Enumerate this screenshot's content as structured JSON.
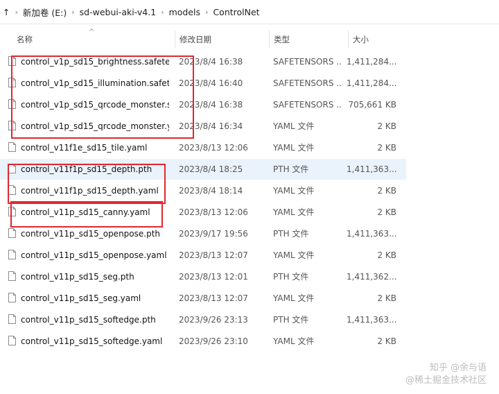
{
  "breadcrumb": {
    "lead": "↑",
    "items": [
      "新加卷 (E:)",
      "sd-webui-aki-v4.1",
      "models",
      "ControlNet"
    ]
  },
  "columns": {
    "name": "名称",
    "date": "修改日期",
    "type": "类型",
    "size": "大小"
  },
  "files": [
    {
      "name": "control_v1p_sd15_brightness.safeten...",
      "date": "2023/8/4 16:38",
      "type": "SAFETENSORS ...",
      "size": "1,411,284..."
    },
    {
      "name": "control_v1p_sd15_illumination.safete...",
      "date": "2023/8/4 16:40",
      "type": "SAFETENSORS ...",
      "size": "1,411,284..."
    },
    {
      "name": "control_v1p_sd15_qrcode_monster.s...",
      "date": "2023/8/4 16:38",
      "type": "SAFETENSORS ...",
      "size": "705,661 KB"
    },
    {
      "name": "control_v1p_sd15_qrcode_monster.y...",
      "date": "2023/8/4 16:34",
      "type": "YAML 文件",
      "size": "2 KB"
    },
    {
      "name": "control_v11f1e_sd15_tile.yaml",
      "date": "2023/8/13 12:06",
      "type": "YAML 文件",
      "size": "2 KB"
    },
    {
      "name": "control_v11f1p_sd15_depth.pth",
      "date": "2023/8/4 18:25",
      "type": "PTH 文件",
      "size": "1,411,363..."
    },
    {
      "name": "control_v11f1p_sd15_depth.yaml",
      "date": "2023/8/4 18:14",
      "type": "YAML 文件",
      "size": "2 KB"
    },
    {
      "name": "control_v11p_sd15_canny.yaml",
      "date": "2023/8/13 12:06",
      "type": "YAML 文件",
      "size": "2 KB"
    },
    {
      "name": "control_v11p_sd15_openpose.pth",
      "date": "2023/9/17 19:56",
      "type": "PTH 文件",
      "size": "1,411,363..."
    },
    {
      "name": "control_v11p_sd15_openpose.yaml",
      "date": "2023/8/13 12:07",
      "type": "YAML 文件",
      "size": "2 KB"
    },
    {
      "name": "control_v11p_sd15_seg.pth",
      "date": "2023/8/13 12:01",
      "type": "PTH 文件",
      "size": "1,411,362..."
    },
    {
      "name": "control_v11p_sd15_seg.yaml",
      "date": "2023/8/13 12:07",
      "type": "YAML 文件",
      "size": "2 KB"
    },
    {
      "name": "control_v11p_sd15_softedge.pth",
      "date": "2023/9/26 23:13",
      "type": "PTH 文件",
      "size": "1,411,363..."
    },
    {
      "name": "control_v11p_sd15_softedge.yaml",
      "date": "2023/9/26 23:10",
      "type": "YAML 文件",
      "size": "2 KB"
    }
  ],
  "selected_index": 5,
  "watermark": {
    "line1": "知乎 @余与语",
    "line2": "@稀土掘金技术社区"
  },
  "colors": {
    "highlight": "#e0262f",
    "selection": "#eaf2fb"
  }
}
